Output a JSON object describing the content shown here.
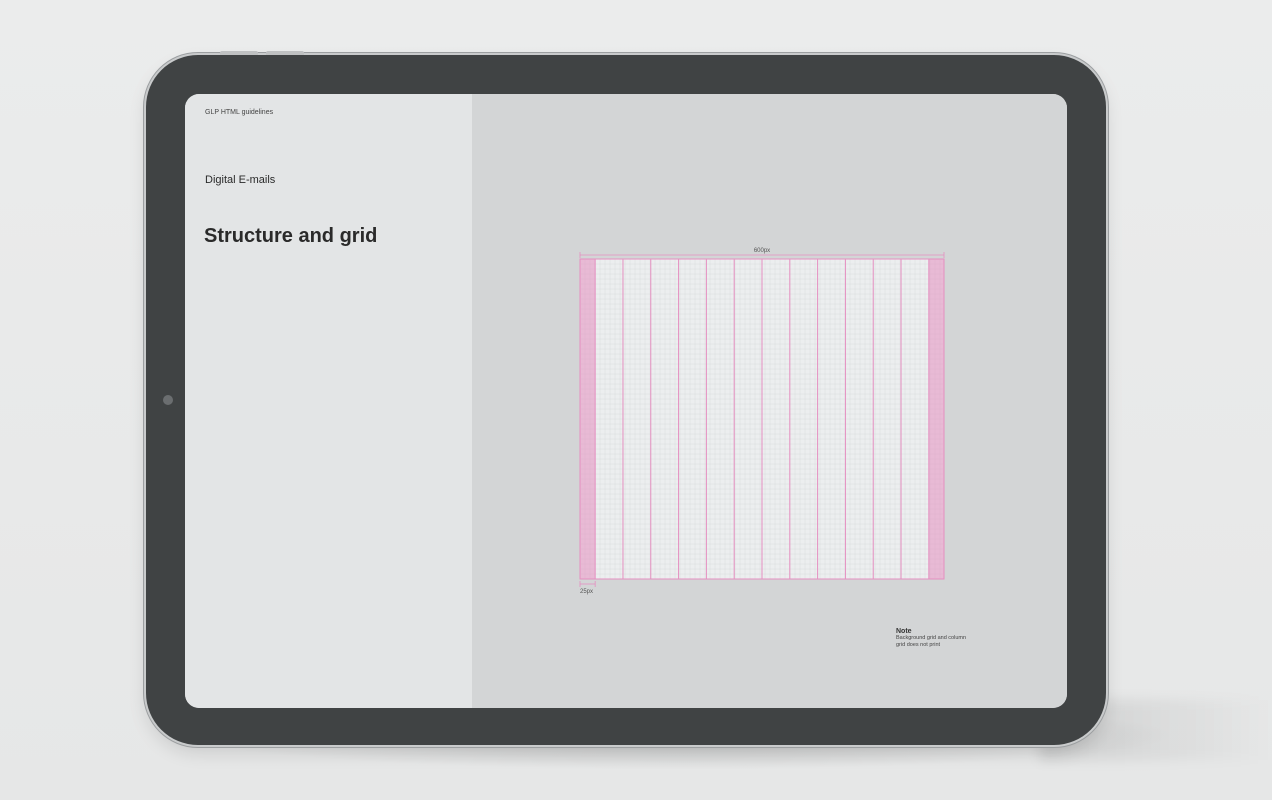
{
  "document": {
    "header": "GLP HTML guidelines",
    "section": "Digital E-mails",
    "title": "Structure and grid"
  },
  "grid_diagram": {
    "width_label": "600px",
    "margin_label": "25px",
    "total_width": 600,
    "margin_width": 25
  },
  "note": {
    "title": "Note",
    "lines": [
      "Background grid and column",
      "grid does not print"
    ]
  },
  "colors": {
    "bezel": "#404344",
    "left_pane": "#e3e5e6",
    "right_pane": "#d3d5d6",
    "grid_accent": "#e58fc0"
  },
  "icons": {
    "camera": "front-camera-icon"
  }
}
